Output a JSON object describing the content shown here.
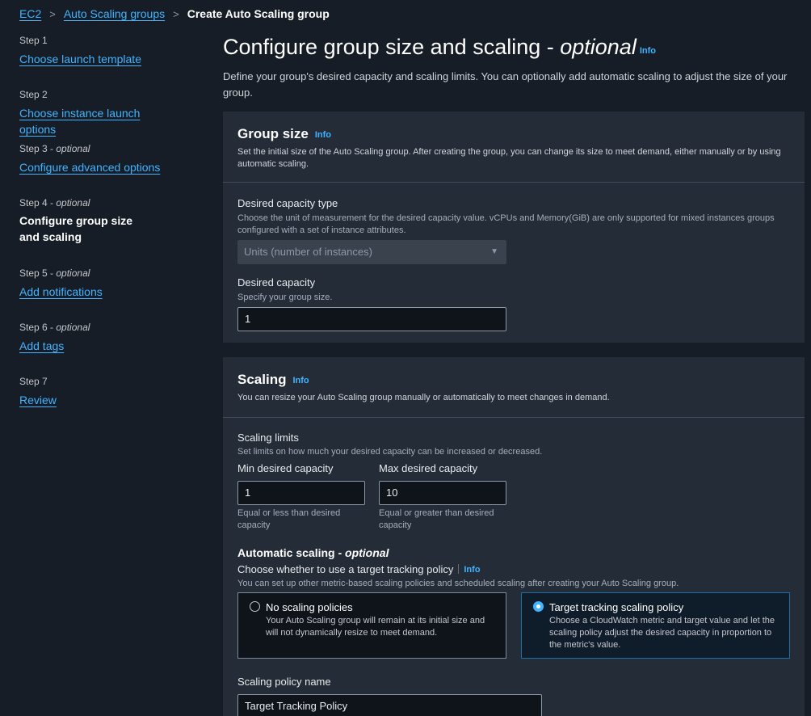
{
  "breadcrumb": {
    "items": [
      "EC2",
      "Auto Scaling groups"
    ],
    "current": "Create Auto Scaling group",
    "separator": ">"
  },
  "steps": [
    {
      "number": "Step 1",
      "optional": "",
      "label": "Choose launch template",
      "current": false
    },
    {
      "number": "Step 2",
      "optional": "",
      "label": "Choose instance launch options",
      "current": false
    },
    {
      "number": "Step 3",
      "optional": "optional",
      "label": "Configure advanced options",
      "current": false
    },
    {
      "number": "Step 4",
      "optional": "optional",
      "label": "Configure group size and scaling",
      "current": true
    },
    {
      "number": "Step 5",
      "optional": "optional",
      "label": "Add notifications",
      "current": false
    },
    {
      "number": "Step 6",
      "optional": "optional",
      "label": "Add tags",
      "current": false
    },
    {
      "number": "Step 7",
      "optional": "",
      "label": "Review",
      "current": false
    }
  ],
  "step_dash": " - ",
  "page": {
    "title": "Configure group size and scaling - ",
    "title_optional": "optional",
    "info": "Info",
    "description": "Define your group's desired capacity and scaling limits. You can optionally add automatic scaling to adjust the size of your group."
  },
  "group_size": {
    "title": "Group size",
    "info": "Info",
    "description": "Set the initial size of the Auto Scaling group. After creating the group, you can change its size to meet demand, either manually or by using automatic scaling.",
    "capacity_type_label": "Desired capacity type",
    "capacity_type_desc": "Choose the unit of measurement for the desired capacity value. vCPUs and Memory(GiB) are only supported for mixed instances groups configured with a set of instance attributes.",
    "capacity_type_value": "Units (number of instances)",
    "desired_label": "Desired capacity",
    "desired_desc": "Specify your group size.",
    "desired_value": "1"
  },
  "scaling": {
    "title": "Scaling",
    "info": "Info",
    "description": "You can resize your Auto Scaling group manually or automatically to meet changes in demand.",
    "limits_label": "Scaling limits",
    "limits_desc": "Set limits on how much your desired capacity can be increased or decreased.",
    "min_label": "Min desired capacity",
    "min_value": "1",
    "min_hint": "Equal or less than desired capacity",
    "max_label": "Max desired capacity",
    "max_value": "10",
    "max_hint": "Equal or greater than desired capacity",
    "auto_title": "Automatic scaling - ",
    "auto_optional": "optional",
    "choose_label": "Choose whether to use a target tracking policy",
    "choose_info": "Info",
    "choose_desc": "You can set up other metric-based scaling policies and scheduled scaling after creating your Auto Scaling group.",
    "option_none_title": "No scaling policies",
    "option_none_desc": "Your Auto Scaling group will remain at its initial size and will not dynamically resize to meet demand.",
    "option_target_title": "Target tracking scaling policy",
    "option_target_desc": "Choose a CloudWatch metric and target value and let the scaling policy adjust the desired capacity in proportion to the metric's value.",
    "selected_option": "target",
    "policy_name_label": "Scaling policy name",
    "policy_name_value": "Target Tracking Policy"
  },
  "colors": {
    "link": "#42b4ff",
    "background": "#161d26",
    "panel": "#242c38",
    "selected_border": "#1e6fa8"
  }
}
